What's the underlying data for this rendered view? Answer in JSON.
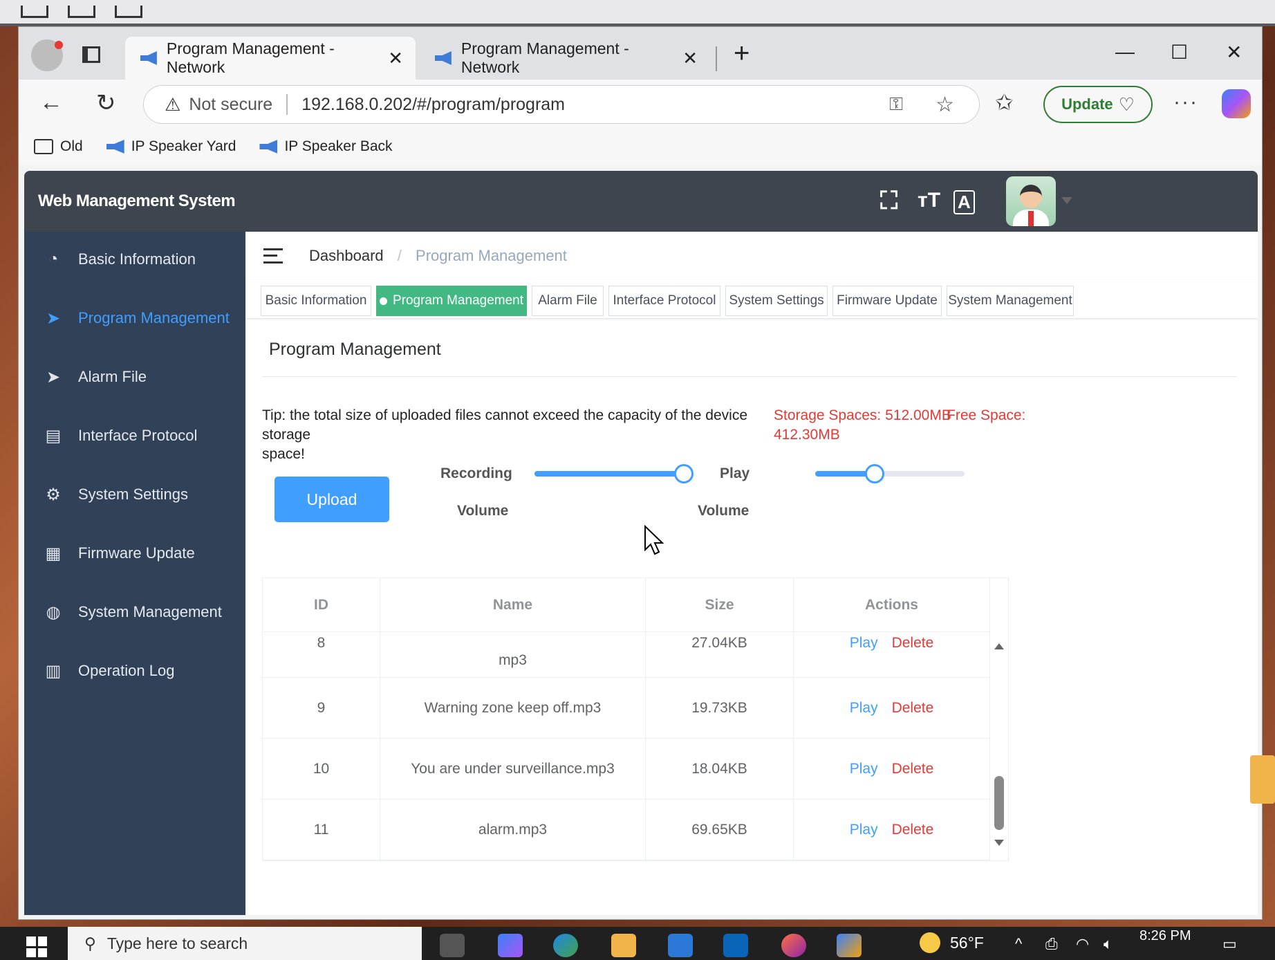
{
  "browser": {
    "tabs": [
      {
        "label": "Program Management - Network",
        "active": true
      },
      {
        "label": "Program Management - Network",
        "active": false
      }
    ],
    "address": {
      "security_label": "Not secure",
      "url": "192.168.0.202/#/program/program"
    },
    "update_label": "Update",
    "bookmarks": [
      {
        "label": "Old",
        "icon": "folder-icon"
      },
      {
        "label": "IP Speaker Yard",
        "icon": "speaker-icon"
      },
      {
        "label": "IP Speaker Back",
        "icon": "speaker-icon"
      }
    ]
  },
  "app": {
    "title": "Web Management System",
    "header_icons": [
      "fullscreen-icon",
      "font-size-icon",
      "translate-icon"
    ]
  },
  "sidebar": {
    "items": [
      {
        "label": "Basic Information",
        "icon": "dashboard-icon",
        "active": false
      },
      {
        "label": "Program Management",
        "icon": "send-icon",
        "active": true
      },
      {
        "label": "Alarm File",
        "icon": "send-icon",
        "active": false
      },
      {
        "label": "Interface Protocol",
        "icon": "document-icon",
        "active": false
      },
      {
        "label": "System Settings",
        "icon": "gear-icon",
        "active": false
      },
      {
        "label": "Firmware Update",
        "icon": "grid-icon",
        "active": false
      },
      {
        "label": "System Management",
        "icon": "globe-icon",
        "active": false
      },
      {
        "label": "Operation Log",
        "icon": "log-icon",
        "active": false
      }
    ]
  },
  "breadcrumb": {
    "root": "Dashboard",
    "separator": "/",
    "current": "Program Management"
  },
  "tags": [
    {
      "label": "Basic Information",
      "active": false
    },
    {
      "label": "Program Management",
      "active": true
    },
    {
      "label": "Alarm File",
      "active": false
    },
    {
      "label": "Interface Protocol",
      "active": false
    },
    {
      "label": "System Settings",
      "active": false
    },
    {
      "label": "Firmware Update",
      "active": false
    },
    {
      "label": "System Management",
      "active": false
    }
  ],
  "page": {
    "title": "Program Management",
    "tip_line1": "Tip: the total size of uploaded files cannot exceed the capacity of the device storage",
    "tip_line2": "space!",
    "storage": "Storage Spaces: 512.00MB",
    "free_label": "Free Space:",
    "free_value": "412.30MB",
    "upload_label": "Upload",
    "recording_label_1": "Recording",
    "recording_label_2": "Volume",
    "play_label_1": "Play",
    "play_label_2": "Volume",
    "recording_volume": 1.0,
    "play_volume": 0.4
  },
  "table": {
    "headers": [
      "ID",
      "Name",
      "Size",
      "Actions"
    ],
    "play_label": "Play",
    "delete_label": "Delete",
    "rows": [
      {
        "id": "8",
        "name": "mp3",
        "size": "27.04KB"
      },
      {
        "id": "9",
        "name": "Warning zone keep off.mp3",
        "size": "19.73KB"
      },
      {
        "id": "10",
        "name": "You are under surveillance.mp3",
        "size": "18.04KB"
      },
      {
        "id": "11",
        "name": "alarm.mp3",
        "size": "69.65KB"
      }
    ]
  },
  "taskbar": {
    "search_placeholder": "Type here to search",
    "weather": "56°F",
    "time": "8:26 PM"
  },
  "colors": {
    "primary": "#409eff",
    "danger": "#e53935",
    "tag_active": "#42b983",
    "sidebar_bg": "#314158",
    "header_bg": "#3e454f"
  }
}
